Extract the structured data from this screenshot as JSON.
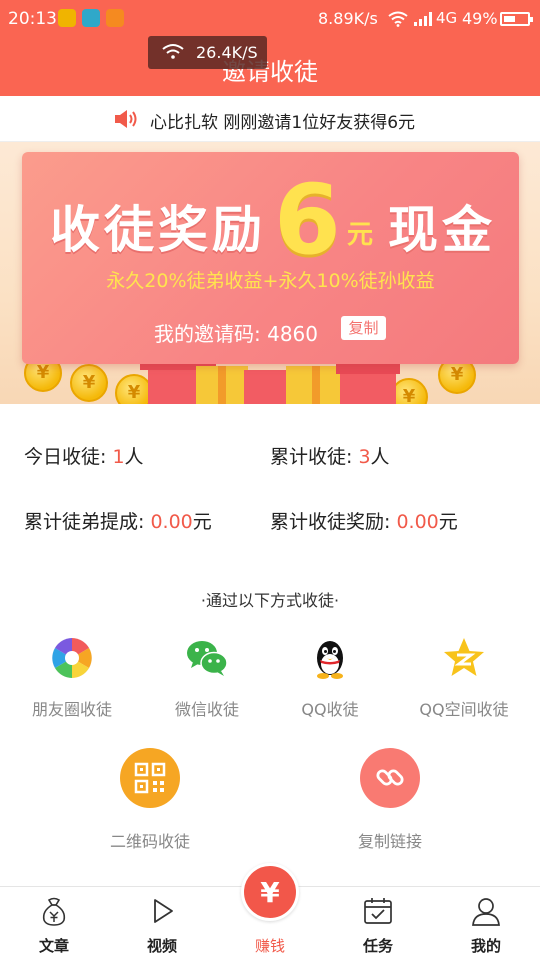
{
  "status_bar": {
    "time": "20:13",
    "net_speed": "8.89K/s",
    "network": "4G",
    "battery": "49%",
    "float_speed": "26.4K/S"
  },
  "header": {
    "title": "邀请收徒"
  },
  "notice": {
    "text": "心比扎软 刚刚邀请1位好友获得6元"
  },
  "banner": {
    "title_left": "收徒奖励",
    "amount": "6",
    "unit": "元",
    "title_right": "现金",
    "subtitle": "永久20%徒弟收益+永久10%徒孙收益",
    "invite_label": "我的邀请码:",
    "invite_code": "4860",
    "copy_label": "复制"
  },
  "stats": {
    "today": {
      "label": "今日收徒: ",
      "value": "1",
      "unit": "人"
    },
    "total": {
      "label": "累计收徒: ",
      "value": "3",
      "unit": "人"
    },
    "commission": {
      "label": "累计徒弟提成: ",
      "value": "0.00",
      "unit": "元"
    },
    "reward": {
      "label": "累计收徒奖励: ",
      "value": "0.00",
      "unit": "元"
    }
  },
  "methods": {
    "title": "·通过以下方式收徒·",
    "items": [
      {
        "label": "朋友圈收徒",
        "icon": "moments-icon"
      },
      {
        "label": "微信收徒",
        "icon": "wechat-icon"
      },
      {
        "label": "QQ收徒",
        "icon": "qq-icon"
      },
      {
        "label": "QQ空间收徒",
        "icon": "qzone-icon"
      },
      {
        "label": "二维码收徒",
        "icon": "qrcode-icon"
      },
      {
        "label": "复制链接",
        "icon": "link-icon"
      }
    ]
  },
  "bottom_nav": {
    "items": [
      {
        "label": "文章",
        "icon": "money-bag-icon"
      },
      {
        "label": "视频",
        "icon": "play-icon"
      },
      {
        "label": "赚钱",
        "icon": "yuan-icon"
      },
      {
        "label": "任务",
        "icon": "calendar-check-icon"
      },
      {
        "label": "我的",
        "icon": "user-icon"
      }
    ],
    "center_symbol": "¥"
  },
  "colors": {
    "primary": "#fa6552",
    "accent_red": "#f15a4a",
    "gold": "#ffe24f"
  }
}
